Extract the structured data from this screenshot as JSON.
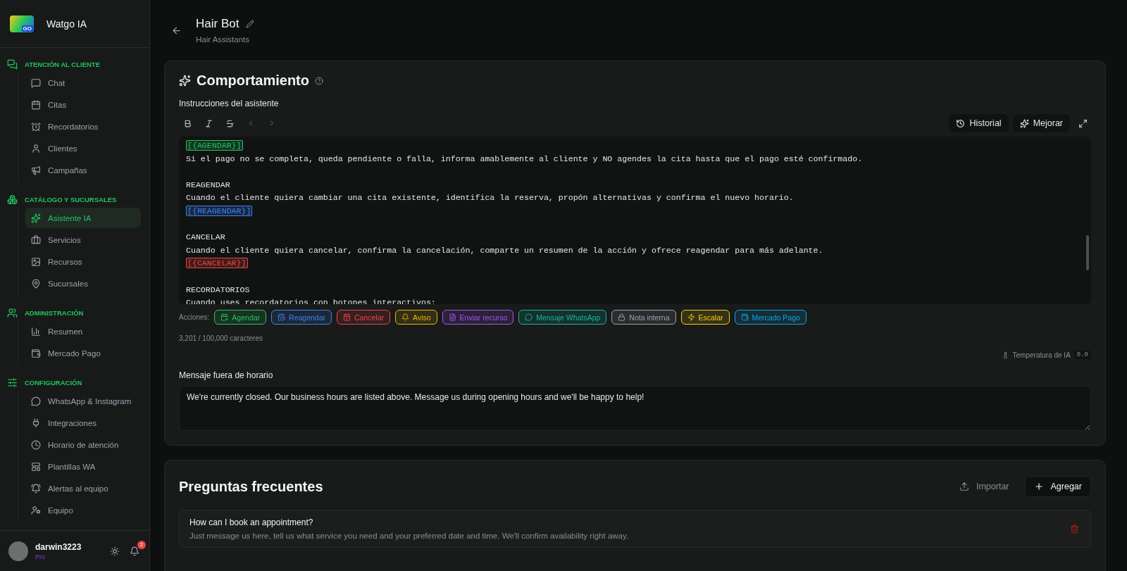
{
  "brand": {
    "name": "Watgo IA",
    "logo_text": "GO"
  },
  "sidebar": {
    "sections": [
      {
        "title": "ATENCIÓN AL CLIENTE",
        "items": [
          {
            "label": "Chat",
            "selected": false
          },
          {
            "label": "Citas",
            "selected": false
          },
          {
            "label": "Recordatorios",
            "selected": false
          },
          {
            "label": "Clientes",
            "selected": false
          },
          {
            "label": "Campañas",
            "selected": false
          }
        ]
      },
      {
        "title": "CATÁLOGO Y SUCURSALES",
        "items": [
          {
            "label": "Asistente IA",
            "selected": true
          },
          {
            "label": "Servicios",
            "selected": false
          },
          {
            "label": "Recursos",
            "selected": false
          },
          {
            "label": "Sucursales",
            "selected": false
          }
        ]
      },
      {
        "title": "ADMINISTRACIÓN",
        "items": [
          {
            "label": "Resumen",
            "selected": false
          },
          {
            "label": "Mercado Pago",
            "selected": false
          }
        ]
      },
      {
        "title": "CONFIGURACIÓN",
        "items": [
          {
            "label": "WhatsApp & Instagram",
            "selected": false
          },
          {
            "label": "Integraciones",
            "selected": false
          },
          {
            "label": "Horario de atención",
            "selected": false
          },
          {
            "label": "Plantillas WA",
            "selected": false
          },
          {
            "label": "Alertas al equipo",
            "selected": false
          },
          {
            "label": "Equipo",
            "selected": false
          }
        ]
      }
    ]
  },
  "user": {
    "name": "darwin3223",
    "plan": "Pro",
    "notifications": "2"
  },
  "header": {
    "title": "Hair Bot",
    "subtitle": "Hair Assistants"
  },
  "behavior": {
    "title": "Comportamiento",
    "instructions_label": "Instrucciones del asistente",
    "history_button": "Historial",
    "improve_button": "Mejorar",
    "editor_lines": [
      {
        "kind": "tag",
        "text": "[{AGENDAR}]",
        "color": "#22c55e"
      },
      {
        "kind": "text",
        "text": "Si el pago no se completa, queda pendiente o falla, informa amablemente al cliente y NO agendes la cita hasta que el pago esté confirmado."
      },
      {
        "kind": "blank"
      },
      {
        "kind": "text",
        "text": "REAGENDAR"
      },
      {
        "kind": "text",
        "text": "Cuando el cliente quiera cambiar una cita existente, identifica la reserva, propón alternativas y confirma el nuevo horario."
      },
      {
        "kind": "tag",
        "text": "[{REAGENDAR}]",
        "color": "#3b82f6"
      },
      {
        "kind": "blank"
      },
      {
        "kind": "text",
        "text": "CANCELAR"
      },
      {
        "kind": "text",
        "text": "Cuando el cliente quiera cancelar, confirma la cancelación, comparte un resumen de la acción y ofrece reagendar para más adelante."
      },
      {
        "kind": "tag",
        "text": "[{CANCELAR}]",
        "color": "#ef4444"
      },
      {
        "kind": "blank"
      },
      {
        "kind": "text",
        "text": "RECORDATORIOS"
      },
      {
        "kind": "text",
        "text": "Cuando uses recordatorios con botones interactivos:"
      }
    ],
    "actions_label": "Acciones:",
    "actions": [
      {
        "label": "Agendar",
        "color": "#22c55e"
      },
      {
        "label": "Reagendar",
        "color": "#3b82f6"
      },
      {
        "label": "Cancelar",
        "color": "#ef4444"
      },
      {
        "label": "Aviso",
        "color": "#eab308"
      },
      {
        "label": "Enviar recurso",
        "color": "#a855f7"
      },
      {
        "label": "Mensaje WhatsApp",
        "color": "#14b8a6"
      },
      {
        "label": "Nota interna",
        "color": "#9ca3af"
      },
      {
        "label": "Escalar",
        "color": "#facc15"
      },
      {
        "label": "Mercado Pago",
        "color": "#0ea5e9"
      }
    ],
    "char_count": "3,201 / 100,000 caracteres",
    "temperature_label": "Temperatura de IA",
    "temperature_value": "0.0",
    "closed_label": "Mensaje fuera de horario",
    "closed_message": "We're currently closed. Our business hours are listed above. Message us during opening hours and we'll be happy to help!"
  },
  "faq": {
    "title": "Preguntas frecuentes",
    "import_button": "Importar",
    "add_button": "Agregar",
    "items": [
      {
        "question": "How can I book an appointment?",
        "answer": "Just message us here, tell us what service you need and your preferred date and time. We'll confirm availability right away."
      }
    ]
  }
}
